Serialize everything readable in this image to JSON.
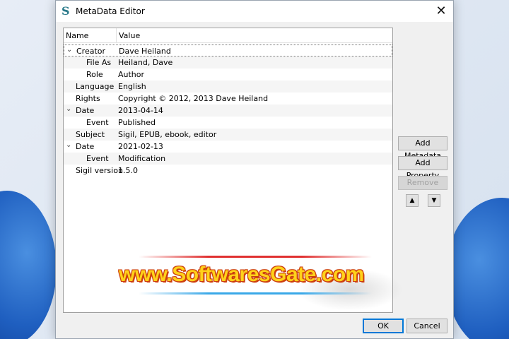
{
  "window": {
    "title": "MetaData Editor",
    "icon": "sigil-icon",
    "close_icon": "close-icon"
  },
  "tree": {
    "columns": [
      "Name",
      "Value"
    ],
    "rows": [
      {
        "level": 0,
        "expanded": true,
        "key": "Creator",
        "value": "Dave Heiland"
      },
      {
        "level": 1,
        "expanded": null,
        "key": "File As",
        "value": "Heiland, Dave"
      },
      {
        "level": 1,
        "expanded": null,
        "key": "Role",
        "value": "Author"
      },
      {
        "level": 0,
        "expanded": null,
        "key": "Language",
        "value": "English"
      },
      {
        "level": 0,
        "expanded": null,
        "key": "Rights",
        "value": "Copyright © 2012, 2013 Dave Heiland"
      },
      {
        "level": 0,
        "expanded": true,
        "key": "Date",
        "value": "2013-04-14"
      },
      {
        "level": 1,
        "expanded": null,
        "key": "Event",
        "value": "Published"
      },
      {
        "level": 0,
        "expanded": null,
        "key": "Subject",
        "value": "Sigil, EPUB, ebook, editor"
      },
      {
        "level": 0,
        "expanded": true,
        "key": "Date",
        "value": "2021-02-13"
      },
      {
        "level": 1,
        "expanded": null,
        "key": "Event",
        "value": "Modification"
      },
      {
        "level": 0,
        "expanded": null,
        "key": "Sigil version",
        "value": "1.5.0"
      }
    ]
  },
  "buttons": {
    "add_metadata": "Add Metadata",
    "add_property": "Add Property",
    "remove": "Remove",
    "move_up": "▲",
    "move_down": "▼",
    "ok": "OK",
    "cancel": "Cancel"
  },
  "watermark": {
    "text": "www.SoftwaresGate.com"
  },
  "colors": {
    "accent": "#0078d7",
    "watermark_fill": "#ffd21a",
    "watermark_outline": "#d04010"
  }
}
